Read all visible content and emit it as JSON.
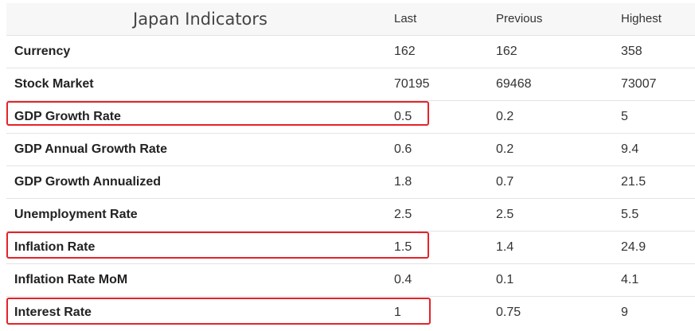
{
  "header": {
    "title": "Japan Indicators",
    "col_last": "Last",
    "col_previous": "Previous",
    "col_highest": "Highest"
  },
  "rows": [
    {
      "name": "Currency",
      "last": "162",
      "previous": "162",
      "highest": "358"
    },
    {
      "name": "Stock Market",
      "last": "70195",
      "previous": "69468",
      "highest": "73007"
    },
    {
      "name": "GDP Growth Rate",
      "last": "0.5",
      "previous": "0.2",
      "highest": "5"
    },
    {
      "name": "GDP Annual Growth Rate",
      "last": "0.6",
      "previous": "0.2",
      "highest": "9.4"
    },
    {
      "name": "GDP Growth Annualized",
      "last": "1.8",
      "previous": "0.7",
      "highest": "21.5"
    },
    {
      "name": "Unemployment Rate",
      "last": "2.5",
      "previous": "2.5",
      "highest": "5.5"
    },
    {
      "name": "Inflation Rate",
      "last": "1.5",
      "previous": "1.4",
      "highest": "24.9"
    },
    {
      "name": "Inflation Rate MoM",
      "last": "0.4",
      "previous": "0.1",
      "highest": "4.1"
    },
    {
      "name": "Interest Rate",
      "last": "1",
      "previous": "0.75",
      "highest": "9"
    }
  ],
  "highlight_color": "#e4232a"
}
